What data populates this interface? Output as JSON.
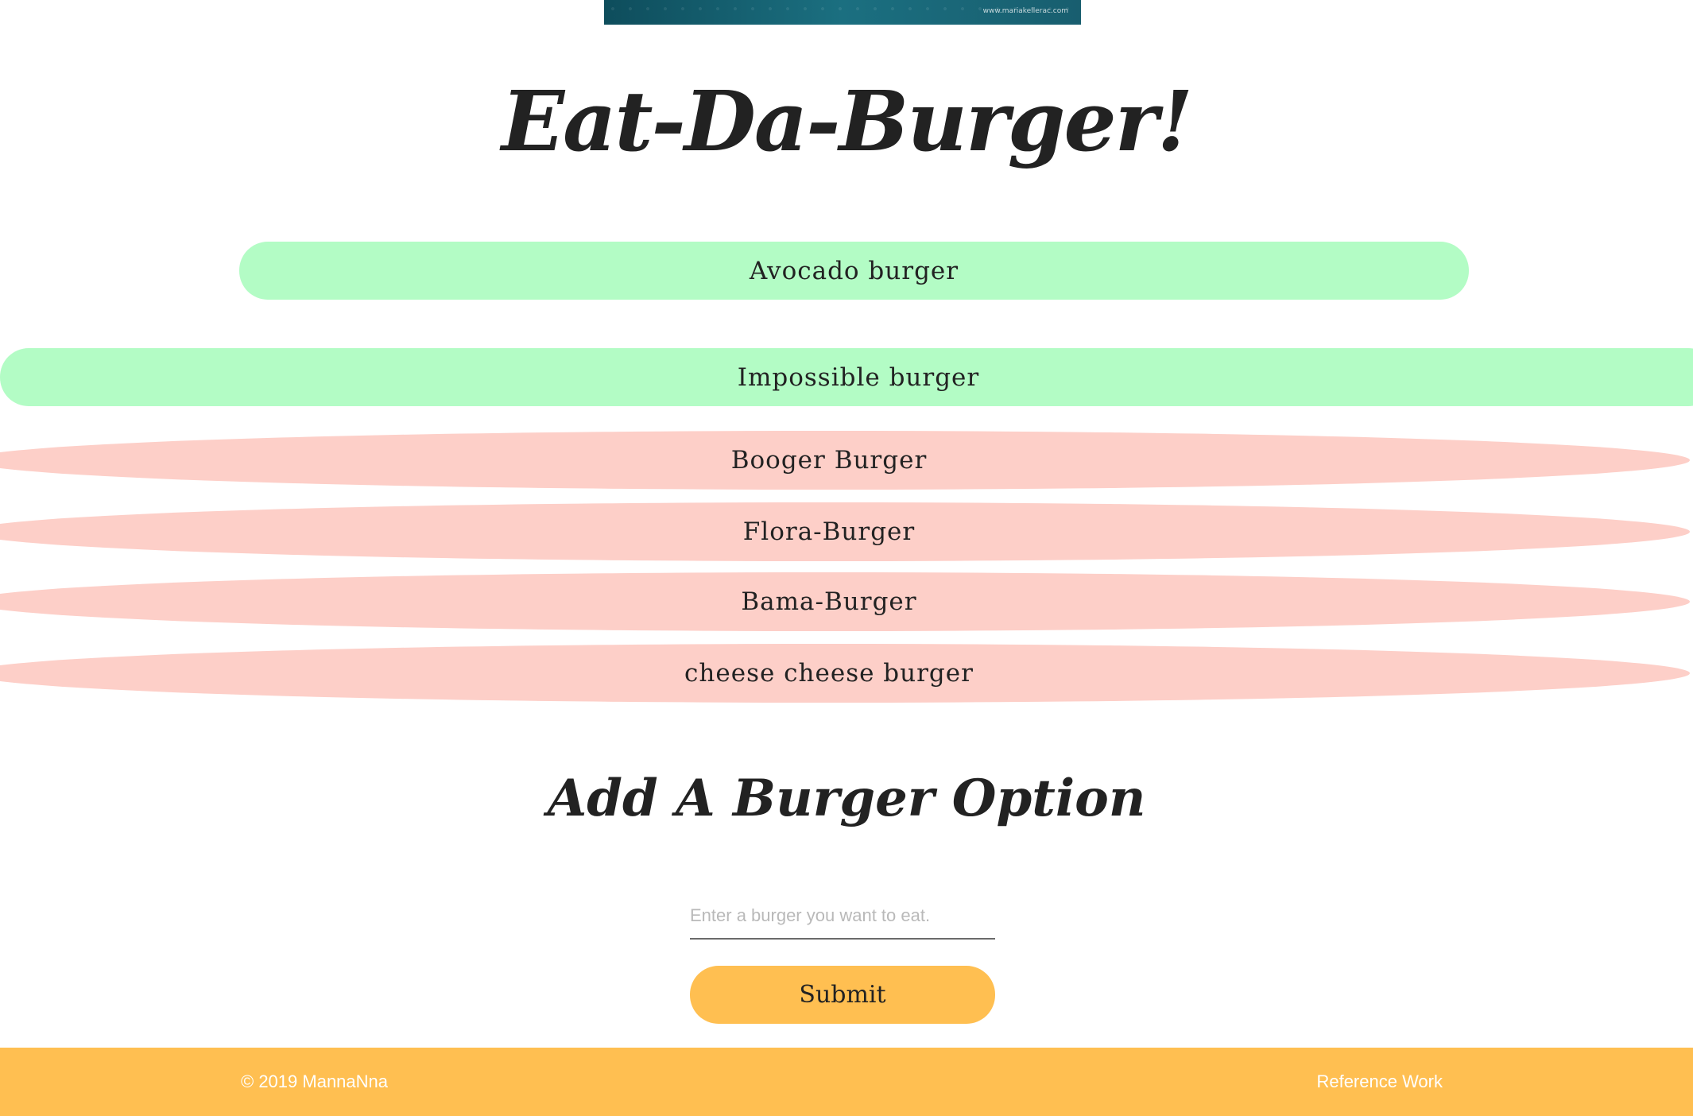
{
  "header": {
    "image_caption": "www.mariakellerac.com",
    "title": "Eat-Da-Burger!"
  },
  "burgers_to_eat": [
    {
      "name": "Avocado burger"
    },
    {
      "name": "Impossible burger"
    }
  ],
  "burgers_eaten": [
    {
      "name": "Booger Burger"
    },
    {
      "name": "Flora-Burger"
    },
    {
      "name": "Bama-Burger"
    },
    {
      "name": "cheese cheese burger"
    }
  ],
  "add_form": {
    "heading": "Add A Burger Option",
    "placeholder": "Enter a burger you want to eat.",
    "submit_label": "Submit"
  },
  "footer": {
    "copyright": "© 2019 MannaNna",
    "link_label": "Reference Work"
  },
  "colors": {
    "available": "#b3fcc5",
    "eaten": "#fdcfc8",
    "accent": "#ffbf51",
    "text": "#222222"
  }
}
